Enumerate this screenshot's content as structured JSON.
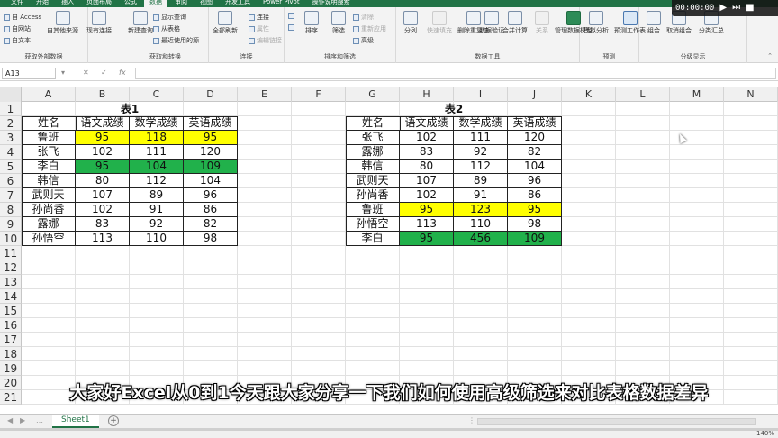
{
  "ribbon_tabs": [
    "文件",
    "开始",
    "插入",
    "页面布局",
    "公式",
    "数据",
    "审阅",
    "视图",
    "开发工具",
    "Power Pivot",
    "操作说明搜索"
  ],
  "active_tab_index": 5,
  "ribbon": {
    "get_external": {
      "label": "获取外部数据",
      "items": [
        "自 Access",
        "自网站",
        "自文本",
        "自其他来源",
        "现有连接"
      ]
    },
    "get_transform": {
      "label": "获取和转换",
      "items": [
        "新建查询",
        "显示查询",
        "从表格",
        "最近使用的源"
      ]
    },
    "connections": {
      "label": "连接",
      "items": [
        "全部刷新",
        "连接",
        "属性",
        "编辑链接"
      ]
    },
    "sort_filter": {
      "label": "排序和筛选",
      "items": [
        "排序",
        "筛选",
        "清除",
        "重新应用",
        "高级"
      ]
    },
    "data_tools": {
      "label": "数据工具",
      "items": [
        "分列",
        "快速填充",
        "删除重复值",
        "数据验证",
        "合并计算",
        "关系",
        "管理数据模型"
      ]
    },
    "forecast": {
      "label": "预测",
      "items": [
        "模拟分析",
        "预测工作表"
      ]
    },
    "outline": {
      "label": "分级显示",
      "items": [
        "组合",
        "取消组合",
        "分类汇总"
      ]
    }
  },
  "video": {
    "time": "00:00:00",
    "play_icon": "play-icon",
    "next_icon": "skip-next-icon",
    "stop_icon": "stop-icon"
  },
  "formula_bar": {
    "name_box": "A13",
    "fx": "fx"
  },
  "columns": [
    "A",
    "B",
    "C",
    "D",
    "E",
    "F",
    "G",
    "H",
    "I",
    "J",
    "K",
    "L",
    "M",
    "N"
  ],
  "rows": [
    "1",
    "2",
    "3",
    "4",
    "5",
    "6",
    "7",
    "8",
    "9",
    "10",
    "11",
    "12",
    "13",
    "14",
    "15",
    "16",
    "17",
    "18",
    "19",
    "20",
    "21"
  ],
  "table1": {
    "title": "表1",
    "headers": [
      "姓名",
      "语文成绩",
      "数学成绩",
      "英语成绩"
    ],
    "rows": [
      {
        "cells": [
          "鲁班",
          "95",
          "118",
          "95"
        ],
        "highlight": "yellow"
      },
      {
        "cells": [
          "张飞",
          "102",
          "111",
          "120"
        ],
        "highlight": ""
      },
      {
        "cells": [
          "李白",
          "95",
          "104",
          "109"
        ],
        "highlight": "green"
      },
      {
        "cells": [
          "韩信",
          "80",
          "112",
          "104"
        ],
        "highlight": ""
      },
      {
        "cells": [
          "武则天",
          "107",
          "89",
          "96"
        ],
        "highlight": ""
      },
      {
        "cells": [
          "孙尚香",
          "102",
          "91",
          "86"
        ],
        "highlight": ""
      },
      {
        "cells": [
          "露娜",
          "83",
          "92",
          "82"
        ],
        "highlight": ""
      },
      {
        "cells": [
          "孙悟空",
          "113",
          "110",
          "98"
        ],
        "highlight": ""
      }
    ]
  },
  "table2": {
    "title": "表2",
    "headers": [
      "姓名",
      "语文成绩",
      "数学成绩",
      "英语成绩"
    ],
    "rows": [
      {
        "cells": [
          "张飞",
          "102",
          "111",
          "120"
        ],
        "highlight": ""
      },
      {
        "cells": [
          "露娜",
          "83",
          "92",
          "82"
        ],
        "highlight": ""
      },
      {
        "cells": [
          "韩信",
          "80",
          "112",
          "104"
        ],
        "highlight": ""
      },
      {
        "cells": [
          "武则天",
          "107",
          "89",
          "96"
        ],
        "highlight": ""
      },
      {
        "cells": [
          "孙尚香",
          "102",
          "91",
          "86"
        ],
        "highlight": ""
      },
      {
        "cells": [
          "鲁班",
          "95",
          "123",
          "95"
        ],
        "highlight": "yellow"
      },
      {
        "cells": [
          "孙悟空",
          "113",
          "110",
          "98"
        ],
        "highlight": ""
      },
      {
        "cells": [
          "李白",
          "95",
          "456",
          "109"
        ],
        "highlight": "green"
      }
    ]
  },
  "colors": {
    "yellow": "#ffff00",
    "green": "#21b14b",
    "excel_green": "#217346"
  },
  "caption": "大家好Excel从0到1今天跟大家分享一下我们如何使用高级筛选来对比表格数据差异",
  "sheet_tab": "Sheet1",
  "zoom": "140%",
  "video_progress": 0.0
}
